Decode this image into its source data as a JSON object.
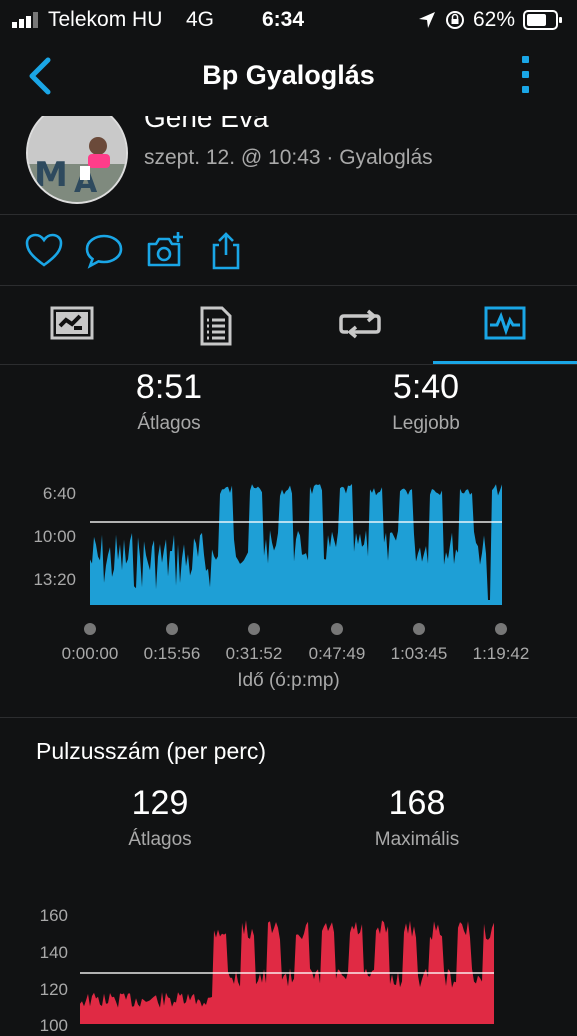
{
  "status": {
    "carrier": "Telekom HU",
    "network": "4G",
    "time": "6:34",
    "battery": "62%"
  },
  "header": {
    "title": "Bp Gyaloglás"
  },
  "activity": {
    "name": "Gene Éva",
    "meta": "szept. 12. @ 10:43 · Gyaloglás"
  },
  "pace": {
    "avg_value": "8:51",
    "avg_label": "Átlagos",
    "best_value": "5:40",
    "best_label": "Legjobb",
    "y_ticks": [
      "6:40",
      "10:00",
      "13:20"
    ],
    "x_ticks": [
      "0:00:00",
      "0:15:56",
      "0:31:52",
      "0:47:49",
      "1:03:45",
      "1:19:42"
    ],
    "x_title": "Idő (ó:p:mp)"
  },
  "heart": {
    "title": "Pulzusszám (per perc)",
    "avg_value": "129",
    "avg_label": "Átlagos",
    "max_value": "168",
    "max_label": "Maximális",
    "y_ticks": [
      "160",
      "140",
      "120",
      "100"
    ]
  },
  "colors": {
    "accent": "#1aa6e6",
    "pace_fill": "#1e9fd6",
    "hr_fill": "#e02a44"
  }
}
